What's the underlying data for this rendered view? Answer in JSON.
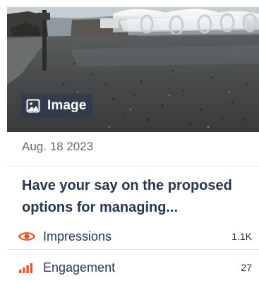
{
  "card": {
    "media_type_label": "Image",
    "date": "Aug. 18 2023",
    "title": "Have your say on the proposed options for managing...",
    "metrics": [
      {
        "label": "Impressions",
        "value": "1.1K",
        "icon": "eye-icon"
      },
      {
        "label": "Engagement",
        "value": "27",
        "icon": "bar-chart-icon"
      }
    ]
  },
  "colors": {
    "accent": "#e4572e",
    "text_primary": "#26364d",
    "text_secondary": "#5c6a7c",
    "badge_bg": "#2e3a4c"
  }
}
